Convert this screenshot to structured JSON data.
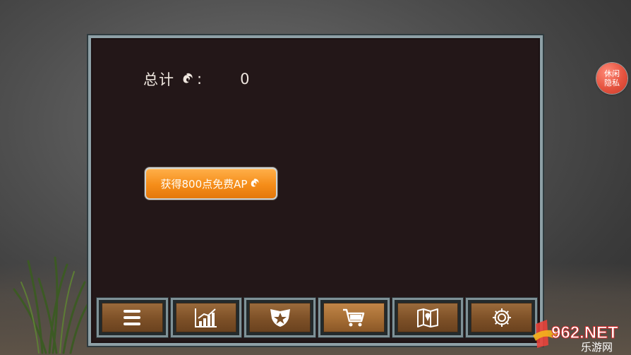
{
  "panel": {
    "total_label": "总计",
    "colon": ":",
    "total_value": "0",
    "free_ap_button": "获得800点免费AP"
  },
  "side_badge": {
    "line1": "休闲",
    "line2": "隐私"
  },
  "nav": {
    "items": [
      {
        "icon": "menu-icon"
      },
      {
        "icon": "stats-chart-icon"
      },
      {
        "icon": "clan-emblem-icon"
      },
      {
        "icon": "shopping-cart-icon",
        "active": true
      },
      {
        "icon": "map-icon"
      },
      {
        "icon": "gear-icon"
      }
    ]
  },
  "watermark": {
    "text": "962.NET",
    "subtext": "乐游网"
  },
  "colors": {
    "panel_bg": "#231718",
    "panel_border": "#8ea0a6",
    "button_orange": "#f58d19",
    "nav_bronze": "#7d5027",
    "badge_red": "#e5533f"
  }
}
